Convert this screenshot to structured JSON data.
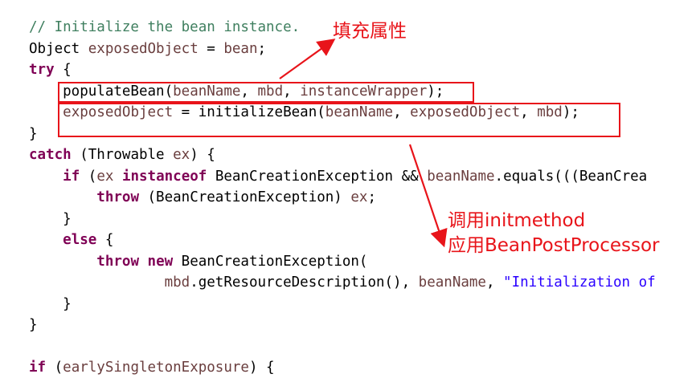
{
  "code": {
    "lines": [
      [
        {
          "t": "// Initialize the bean instance.",
          "k": "comment"
        }
      ],
      [
        {
          "t": "Object ",
          "k": "id"
        },
        {
          "t": "exposedObject",
          "k": "var"
        },
        {
          "t": " = ",
          "k": "id"
        },
        {
          "t": "bean",
          "k": "var"
        },
        {
          "t": ";",
          "k": "id"
        }
      ],
      [
        {
          "t": "try",
          "k": "kw"
        },
        {
          "t": " {",
          "k": "id"
        }
      ],
      [
        {
          "t": "    populateBean(",
          "k": "id"
        },
        {
          "t": "beanName",
          "k": "var"
        },
        {
          "t": ", ",
          "k": "id"
        },
        {
          "t": "mbd",
          "k": "var"
        },
        {
          "t": ", ",
          "k": "id"
        },
        {
          "t": "instanceWrapper",
          "k": "var"
        },
        {
          "t": ");",
          "k": "id"
        }
      ],
      [
        {
          "t": "    ",
          "k": "id"
        },
        {
          "t": "exposedObject",
          "k": "var"
        },
        {
          "t": " = initializeBean(",
          "k": "id"
        },
        {
          "t": "beanName",
          "k": "var"
        },
        {
          "t": ", ",
          "k": "id"
        },
        {
          "t": "exposedObject",
          "k": "var"
        },
        {
          "t": ", ",
          "k": "id"
        },
        {
          "t": "mbd",
          "k": "var"
        },
        {
          "t": ");",
          "k": "id"
        }
      ],
      [
        {
          "t": "}",
          "k": "id"
        }
      ],
      [
        {
          "t": "catch",
          "k": "kw"
        },
        {
          "t": " (Throwable ",
          "k": "id"
        },
        {
          "t": "ex",
          "k": "var"
        },
        {
          "t": ") {",
          "k": "id"
        }
      ],
      [
        {
          "t": "    ",
          "k": "id"
        },
        {
          "t": "if",
          "k": "kw"
        },
        {
          "t": " (",
          "k": "id"
        },
        {
          "t": "ex",
          "k": "var"
        },
        {
          "t": " ",
          "k": "id"
        },
        {
          "t": "instanceof",
          "k": "kw"
        },
        {
          "t": " BeanCreationException && ",
          "k": "id"
        },
        {
          "t": "beanName",
          "k": "var"
        },
        {
          "t": ".equals(((BeanCrea",
          "k": "id"
        }
      ],
      [
        {
          "t": "        ",
          "k": "id"
        },
        {
          "t": "throw",
          "k": "kw"
        },
        {
          "t": " (BeanCreationException) ",
          "k": "id"
        },
        {
          "t": "ex",
          "k": "var"
        },
        {
          "t": ";",
          "k": "id"
        }
      ],
      [
        {
          "t": "    }",
          "k": "id"
        }
      ],
      [
        {
          "t": "    ",
          "k": "id"
        },
        {
          "t": "else",
          "k": "kw"
        },
        {
          "t": " {",
          "k": "id"
        }
      ],
      [
        {
          "t": "        ",
          "k": "id"
        },
        {
          "t": "throw",
          "k": "kw"
        },
        {
          "t": " ",
          "k": "id"
        },
        {
          "t": "new",
          "k": "kw"
        },
        {
          "t": " BeanCreationException(",
          "k": "id"
        }
      ],
      [
        {
          "t": "                ",
          "k": "id"
        },
        {
          "t": "mbd",
          "k": "var"
        },
        {
          "t": ".getResourceDescription(), ",
          "k": "id"
        },
        {
          "t": "beanName",
          "k": "var"
        },
        {
          "t": ", ",
          "k": "id"
        },
        {
          "t": "\"Initialization of",
          "k": "str"
        }
      ],
      [
        {
          "t": "    }",
          "k": "id"
        }
      ],
      [
        {
          "t": "}",
          "k": "id"
        }
      ],
      [
        {
          "t": "",
          "k": "id"
        }
      ],
      [
        {
          "t": "if",
          "k": "kw"
        },
        {
          "t": " (",
          "k": "id"
        },
        {
          "t": "earlySingletonExposure",
          "k": "var"
        },
        {
          "t": ") {",
          "k": "id"
        }
      ]
    ]
  },
  "annotations": {
    "populate": "填充属性",
    "initialize_line1": "调用initmethod",
    "initialize_line2": "应用BeanPostProcessor"
  },
  "colors": {
    "keyword": "#7f0055",
    "variable": "#6a3e3e",
    "comment": "#3f7f5f",
    "string": "#2a00ff",
    "highlight": "#e8141a"
  }
}
